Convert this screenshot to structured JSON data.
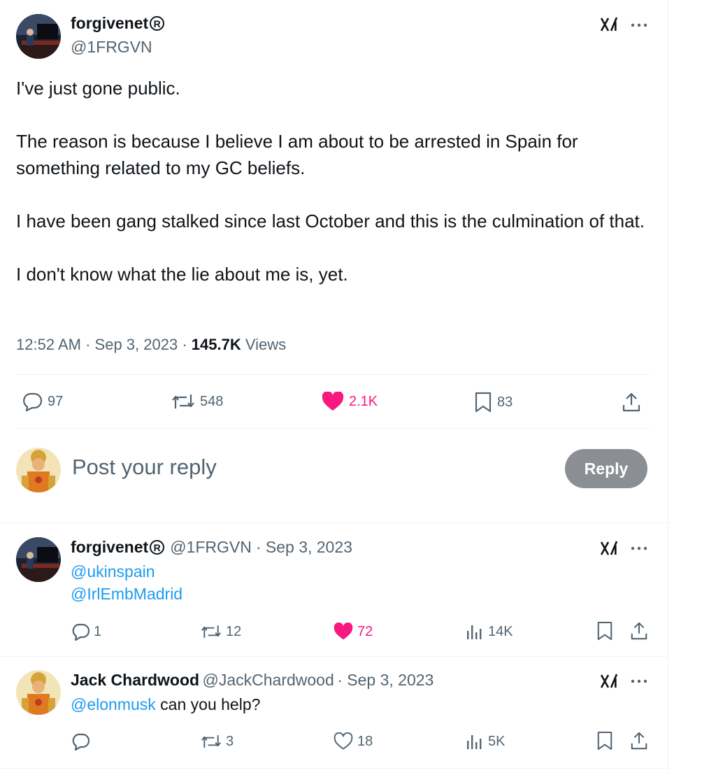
{
  "main_tweet": {
    "author_name": "forgivenet",
    "reg_mark": "R",
    "author_handle": "@1FRGVN",
    "paragraphs": [
      "I've just gone public.",
      "The reason is because I believe I am about to be arrested in Spain for something related to my GC beliefs.",
      "I have been gang stalked since last October and this is the culmination of that.",
      "I don't know what the lie about me is, yet."
    ],
    "time": "12:52 AM",
    "sep1": "·",
    "date": "Sep 3, 2023",
    "sep2": "·",
    "views_count": "145.7K",
    "views_label": "Views",
    "replies": "97",
    "reposts": "548",
    "likes": "2.1K",
    "bookmarks": "83"
  },
  "compose": {
    "placeholder": "Post your reply",
    "button_label": "Reply"
  },
  "replies": [
    {
      "author_name": "forgivenet",
      "reg_mark": "R",
      "author_handle": "@1FRGVN",
      "meta": "· Sep 3, 2023",
      "mention1": "@ukinspain",
      "mention2": "@IrlEmbMadrid",
      "replies": "1",
      "reposts": "12",
      "likes": "72",
      "views": "14K"
    },
    {
      "author_name": "Jack Chardwood",
      "author_handle": "@JackChardwood",
      "meta": "· Sep 3, 2023",
      "mention": "@elonmusk",
      "text": " can you help?",
      "replies": "",
      "reposts": "3",
      "likes": "18",
      "views": "5K"
    }
  ],
  "colors": {
    "accent": "#1d9bf0",
    "like": "#f91880",
    "muted": "#536471",
    "reply_button": "#8b8f93"
  }
}
